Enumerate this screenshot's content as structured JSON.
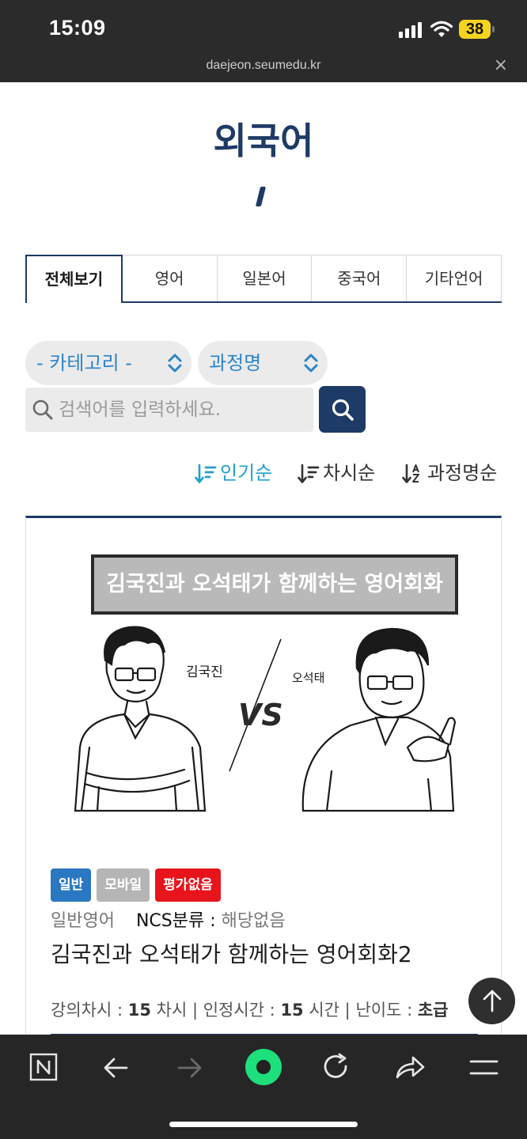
{
  "status": {
    "time": "15:09",
    "battery": "38",
    "url": "daejeon.seumedu.kr",
    "close_label": "×"
  },
  "page": {
    "title": "외국어",
    "accent_color": "#1e3a66"
  },
  "tabs": [
    {
      "label": "전체보기",
      "active": true
    },
    {
      "label": "영어"
    },
    {
      "label": "일본어"
    },
    {
      "label": "중국어"
    },
    {
      "label": "기타언어"
    }
  ],
  "filters": {
    "category": "- 카테고리 -",
    "course": "과정명"
  },
  "search": {
    "placeholder": "검색어를 입력하세요."
  },
  "sort": {
    "popular": "인기순",
    "session": "차시순",
    "name": "과정명순"
  },
  "card": {
    "banner": "김국진과 오석태가 함께하는 영어회화",
    "left_name": "김국진",
    "right_name": "오석태",
    "vs": "VS",
    "badges": [
      "일반",
      "모바일",
      "평가없음"
    ],
    "category": "일반영어",
    "ncs_label": "NCS분류 :",
    "ncs_value": "해당없음",
    "title": "김국진과 오석태가 함께하는 영어회화2",
    "sessions_label": "강의차시 :",
    "sessions_value": "15",
    "sessions_unit": "차시",
    "hours_label": "인정시간 :",
    "hours_value": "15",
    "hours_unit": "시간",
    "level_label": "난이도 :",
    "level_value": "초급"
  },
  "icons": [
    "battery-icon",
    "wifi-icon",
    "signal-icon",
    "search-icon",
    "sort-icon",
    "arrow-up-icon",
    "back-icon",
    "forward-icon",
    "refresh-icon",
    "share-icon",
    "menu-icon",
    "naver-icon"
  ]
}
